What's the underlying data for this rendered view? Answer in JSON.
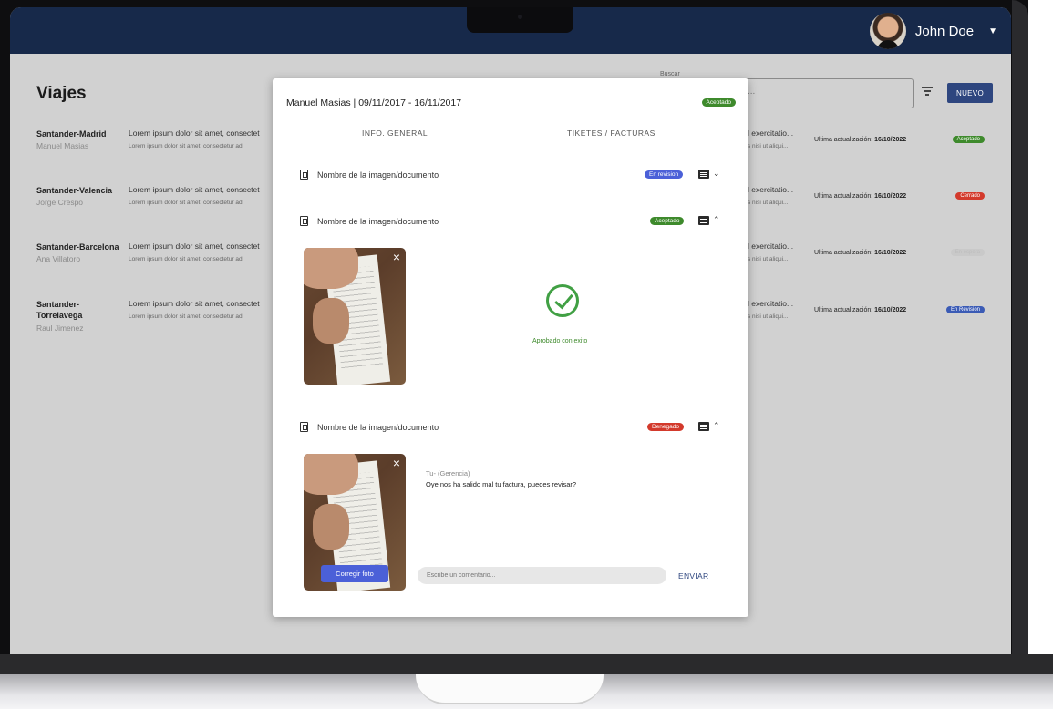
{
  "header": {
    "user_name": "John Doe"
  },
  "page": {
    "title": "Viajes",
    "search_legend": "Buscar",
    "search_value": "...",
    "new_button": "NUEVO"
  },
  "trips": [
    {
      "route": "Santander-Madrid",
      "person": "Manuel Masias",
      "desc": "Lorem ipsum dolor sit amet, consectet",
      "desc2": "Lorem ipsum dolor sit amet, consectetur adi",
      "desc_r": "l exercitatio...",
      "desc_r2": "s nisi ut aliqui...",
      "updated_label": "Ultima actualización:",
      "updated_date": "16/10/2022",
      "status": "Aceptado",
      "status_color": "#3e8a2c"
    },
    {
      "route": "Santander-Valencia",
      "person": "Jorge Crespo",
      "desc": "Lorem ipsum dolor sit amet, consectet",
      "desc2": "Lorem ipsum dolor sit amet, consectetur adi",
      "desc_r": "l exercitatio...",
      "desc_r2": "s nisi ut aliqui...",
      "updated_label": "Ultima actualización:",
      "updated_date": "16/10/2022",
      "status": "Cerrado",
      "status_color": "#d33a2c"
    },
    {
      "route": "Santander-Barcelona",
      "person": "Ana Villatoro",
      "desc": "Lorem ipsum dolor sit amet, consectet",
      "desc2": "Lorem ipsum dolor sit amet, consectetur adi",
      "desc_r": "l exercitatio...",
      "desc_r2": "s nisi ut aliqui...",
      "updated_label": "Ultima actualización:",
      "updated_date": "16/10/2022",
      "status": "En espera",
      "status_color": "#c9c9c9"
    },
    {
      "route": "Santander-Torrelavega",
      "person": "Raul Jimenez",
      "desc": "Lorem ipsum dolor sit amet, consectet",
      "desc2": "Lorem ipsum dolor sit amet, consectetur adi",
      "desc_r": "l exercitatio...",
      "desc_r2": "s nisi ut aliqui...",
      "updated_label": "Ultima actualización:",
      "updated_date": "16/10/2022",
      "status": "En Revisión",
      "status_color": "#3b5bb5"
    }
  ],
  "modal": {
    "person": "Manuel Masias",
    "dates": "09/11/2017 - 16/11/2017",
    "status": "Aceptado",
    "tab_general": "INFO. GENERAL",
    "tab_tickets": "TIKETES / FACTURAS",
    "documents": [
      {
        "name": "Nombre de la  imagen/documento",
        "status": "En revision",
        "status_color": "#4b60d8",
        "chevron": "⌄"
      },
      {
        "name": "Nombre de la  imagen/documento",
        "status": "Aceptado",
        "status_color": "#3e8a2c",
        "chevron": "⌃"
      },
      {
        "name": "Nombre de la  imagen/documento",
        "status": "Denegado",
        "status_color": "#d33a2c",
        "chevron": "⌃"
      }
    ],
    "approved_text": "Aprobado con exito",
    "comment_author": "Tu- (Gerencia)",
    "comment_text": "Oye nos ha salido mal tu factura, puedes revisar?",
    "fix_photo_button": "Corregir foto",
    "comment_placeholder": "Escribe un comentario...",
    "send_button": "ENVIAR",
    "close_glyph": "×"
  }
}
